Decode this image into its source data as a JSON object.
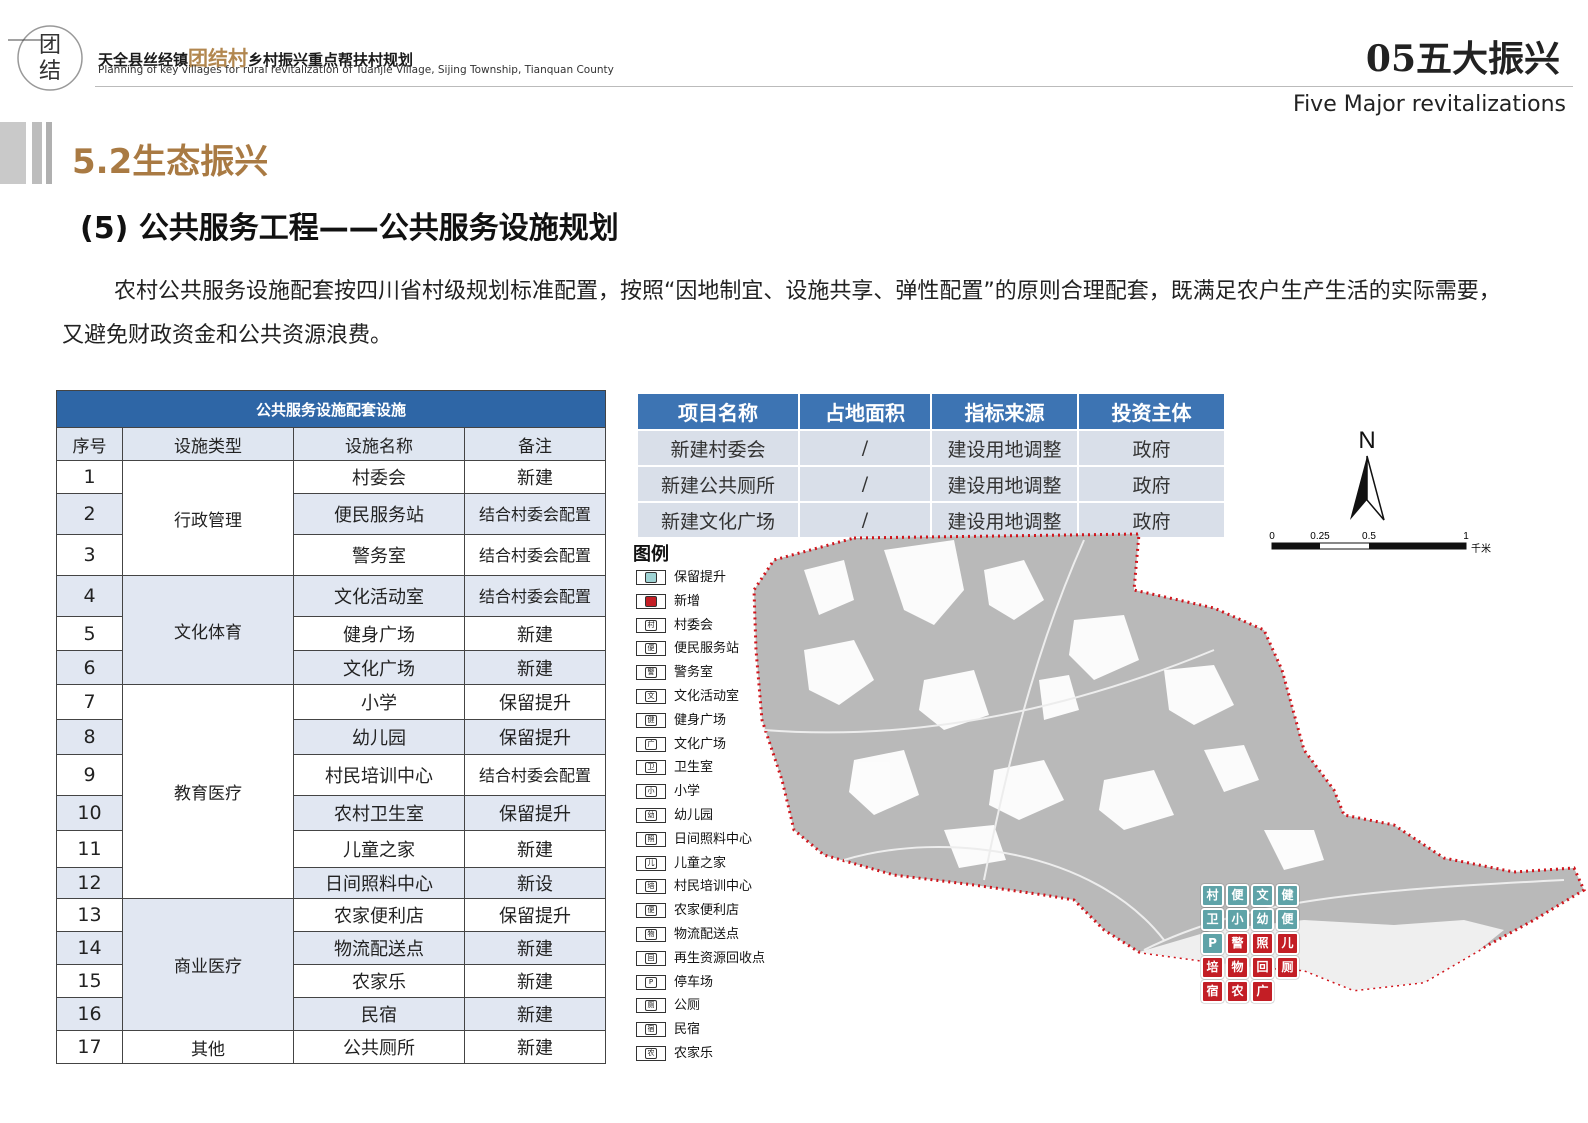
{
  "header": {
    "logo_text_1": "团",
    "logo_text_2": "结",
    "title_prefix": "天全县丝经镇",
    "title_highlight": "团结村",
    "title_suffix": "乡村振兴重点帮扶村规划",
    "subtitle_en": "Planning of key villages for rural revitalization of Tuanjie Village, Sijing Township, Tianquan County",
    "section": "05五大振兴",
    "section_en": "Five Major revitalizations"
  },
  "heading": {
    "h52": "5.2生态振兴",
    "h5": "(5) 公共服务工程——公共服务设施规划"
  },
  "paragraph": "农村公共服务设施配套按四川省村级规划标准配置，按照“因地制宜、设施共享、弹性配置”的原则合理配套，既满足农户生产生活的实际需要，又避免财政资金和公共资源浪费。",
  "left_table": {
    "caption": "公共服务设施配套设施",
    "headers": [
      "序号",
      "设施类型",
      "设施名称",
      "备注"
    ],
    "groups": [
      "行政管理",
      "文化体育",
      "教育医疗",
      "商业医疗",
      "其他"
    ],
    "rows": [
      {
        "no": "1",
        "name": "村委会",
        "note": "新建"
      },
      {
        "no": "2",
        "name": "便民服务站",
        "note": "结合村委会配置"
      },
      {
        "no": "3",
        "name": "警务室",
        "note": "结合村委会配置"
      },
      {
        "no": "4",
        "name": "文化活动室",
        "note": "结合村委会配置"
      },
      {
        "no": "5",
        "name": "健身广场",
        "note": "新建"
      },
      {
        "no": "6",
        "name": "文化广场",
        "note": "新建"
      },
      {
        "no": "7",
        "name": "小学",
        "note": "保留提升"
      },
      {
        "no": "8",
        "name": "幼儿园",
        "note": "保留提升"
      },
      {
        "no": "9",
        "name": "村民培训中心",
        "note": "结合村委会配置"
      },
      {
        "no": "10",
        "name": "农村卫生室",
        "note": "保留提升"
      },
      {
        "no": "11",
        "name": "儿童之家",
        "note": "新建"
      },
      {
        "no": "12",
        "name": "日间照料中心",
        "note": "新设"
      },
      {
        "no": "13",
        "name": "农家便利店",
        "note": "保留提升"
      },
      {
        "no": "14",
        "name": "物流配送点",
        "note": "新建"
      },
      {
        "no": "15",
        "name": "农家乐",
        "note": "新建"
      },
      {
        "no": "16",
        "name": "民宿",
        "note": "新建"
      },
      {
        "no": "17",
        "name": "公共厕所",
        "note": "新建"
      }
    ]
  },
  "right_table": {
    "headers": [
      "项目名称",
      "占地面积",
      "指标来源",
      "投资主体"
    ],
    "rows": [
      [
        "新建村委会",
        "/",
        "建设用地调整",
        "政府"
      ],
      [
        "新建公共厕所",
        "/",
        "建设用地调整",
        "政府"
      ],
      [
        "新建文化广场",
        "/",
        "建设用地调整",
        "政府"
      ]
    ]
  },
  "legend": {
    "title": "图例",
    "items": [
      {
        "label": "保留提升",
        "glyph": "",
        "color": "#9fd3d4"
      },
      {
        "label": "新增",
        "glyph": "",
        "color": "#c31e25"
      },
      {
        "label": "村委会",
        "glyph": "村",
        "color": "#ffffff"
      },
      {
        "label": "便民服务站",
        "glyph": "便",
        "color": "#ffffff"
      },
      {
        "label": "警务室",
        "glyph": "警",
        "color": "#ffffff"
      },
      {
        "label": "文化活动室",
        "glyph": "文",
        "color": "#ffffff"
      },
      {
        "label": "健身广场",
        "glyph": "健",
        "color": "#ffffff"
      },
      {
        "label": "文化广场",
        "glyph": "广",
        "color": "#ffffff"
      },
      {
        "label": "卫生室",
        "glyph": "卫",
        "color": "#ffffff"
      },
      {
        "label": "小学",
        "glyph": "小",
        "color": "#ffffff"
      },
      {
        "label": "幼儿园",
        "glyph": "幼",
        "color": "#ffffff"
      },
      {
        "label": "日间照料中心",
        "glyph": "照",
        "color": "#ffffff"
      },
      {
        "label": "儿童之家",
        "glyph": "儿",
        "color": "#ffffff"
      },
      {
        "label": "村民培训中心",
        "glyph": "培",
        "color": "#ffffff"
      },
      {
        "label": "农家便利店",
        "glyph": "便",
        "color": "#ffffff"
      },
      {
        "label": "物流配送点",
        "glyph": "物",
        "color": "#ffffff"
      },
      {
        "label": "再生资源回收点",
        "glyph": "回",
        "color": "#ffffff"
      },
      {
        "label": "停车场",
        "glyph": "P",
        "color": "#ffffff"
      },
      {
        "label": "公厕",
        "glyph": "厕",
        "color": "#ffffff"
      },
      {
        "label": "民宿",
        "glyph": "宿",
        "color": "#ffffff"
      },
      {
        "label": "农家乐",
        "glyph": "农",
        "color": "#ffffff"
      }
    ]
  },
  "compass": {
    "label": "N"
  },
  "scale": {
    "ticks": [
      "0",
      "0.25",
      "0.5",
      "1"
    ],
    "unit": "千米"
  },
  "map_markers": [
    {
      "glyph": "村",
      "kind": "t"
    },
    {
      "glyph": "便",
      "kind": "t"
    },
    {
      "glyph": "文",
      "kind": "t"
    },
    {
      "glyph": "健",
      "kind": "t"
    },
    {
      "glyph": "卫",
      "kind": "t"
    },
    {
      "glyph": "小",
      "kind": "t"
    },
    {
      "glyph": "幼",
      "kind": "t"
    },
    {
      "glyph": "便",
      "kind": "t"
    },
    {
      "glyph": "P",
      "kind": "t"
    },
    {
      "glyph": "警",
      "kind": "r"
    },
    {
      "glyph": "照",
      "kind": "r"
    },
    {
      "glyph": "儿",
      "kind": "r"
    },
    {
      "glyph": "培",
      "kind": "r"
    },
    {
      "glyph": "物",
      "kind": "r"
    },
    {
      "glyph": "回",
      "kind": "r"
    },
    {
      "glyph": "厕",
      "kind": "r"
    },
    {
      "glyph": "宿",
      "kind": "r"
    },
    {
      "glyph": "农",
      "kind": "r"
    },
    {
      "glyph": "广",
      "kind": "r"
    }
  ],
  "colors": {
    "accent_blue": "#2e66a6",
    "heading_gold": "#a97a43",
    "boundary_red": "#d0151c"
  }
}
